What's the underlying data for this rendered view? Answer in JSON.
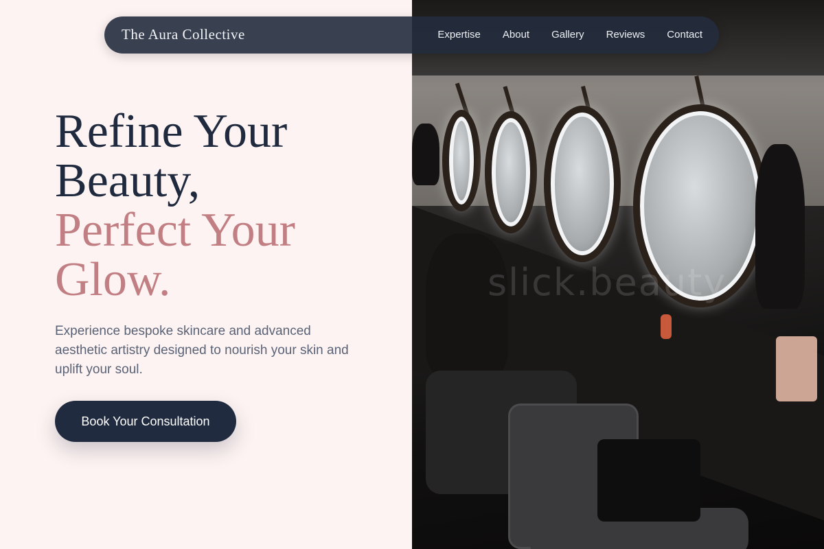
{
  "brand": {
    "name": "The Aura Collective"
  },
  "nav": {
    "links": [
      {
        "label": "Expertise"
      },
      {
        "label": "About"
      },
      {
        "label": "Gallery"
      },
      {
        "label": "Reviews"
      },
      {
        "label": "Contact"
      }
    ]
  },
  "hero": {
    "headline_line1": "Refine Your",
    "headline_line2": "Beauty,",
    "headline_line3": "Perfect Your",
    "headline_line4": "Glow.",
    "subtitle": "Experience bespoke skincare and advanced aesthetic artistry designed to nourish your skin and uplift your soul.",
    "cta_label": "Book Your Consultation"
  },
  "image": {
    "watermark": "slick.beauty"
  },
  "colors": {
    "background": "#fdf3f2",
    "navy": "#202a3f",
    "rose_accent": "#c17f83",
    "body_text": "#5a6275"
  }
}
